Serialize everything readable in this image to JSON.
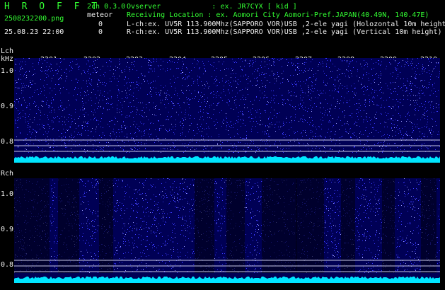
{
  "header": {
    "brand": "H R O F F T",
    "version": "2ch 0.3.0",
    "filename": "2508232200.png",
    "meteor_label": "meteor",
    "datetime": "25.08.23 22:00",
    "meteor_count_l": "0",
    "meteor_count_r": "0"
  },
  "info": {
    "observer": "Ovserver            : ex. JR7CYX [ kid ]",
    "location": "Receiving Location : ex. Aomori City Aomori-Pref.JAPAN(40.49N, 140.47E)",
    "lch": "L-ch:ex. UV5R 113.900Mhz(SAPPORO VOR)USB ,2-ele yagi (Holozontal 10m height)",
    "rch": "R-ch:ex. UV5R 113.900Mhz(SAPPORO VOR)USB ,2-ele yagi (Vertical 10m height)"
  },
  "axis": {
    "lch_label": "Lch",
    "unit": "kHz",
    "rch_label": "Rch",
    "time_ticks": [
      "2201",
      "2202",
      "2203",
      "2204",
      "2205",
      "2206",
      "2207",
      "2208",
      "2209",
      "2210"
    ],
    "freq_ticks": [
      "1.0",
      "0.9",
      "0.8"
    ]
  },
  "colors": {
    "background": "#000000",
    "noise_floor": "#000055",
    "spectrum_trace": "#00e5ff",
    "header_green": "#33ff33"
  }
}
